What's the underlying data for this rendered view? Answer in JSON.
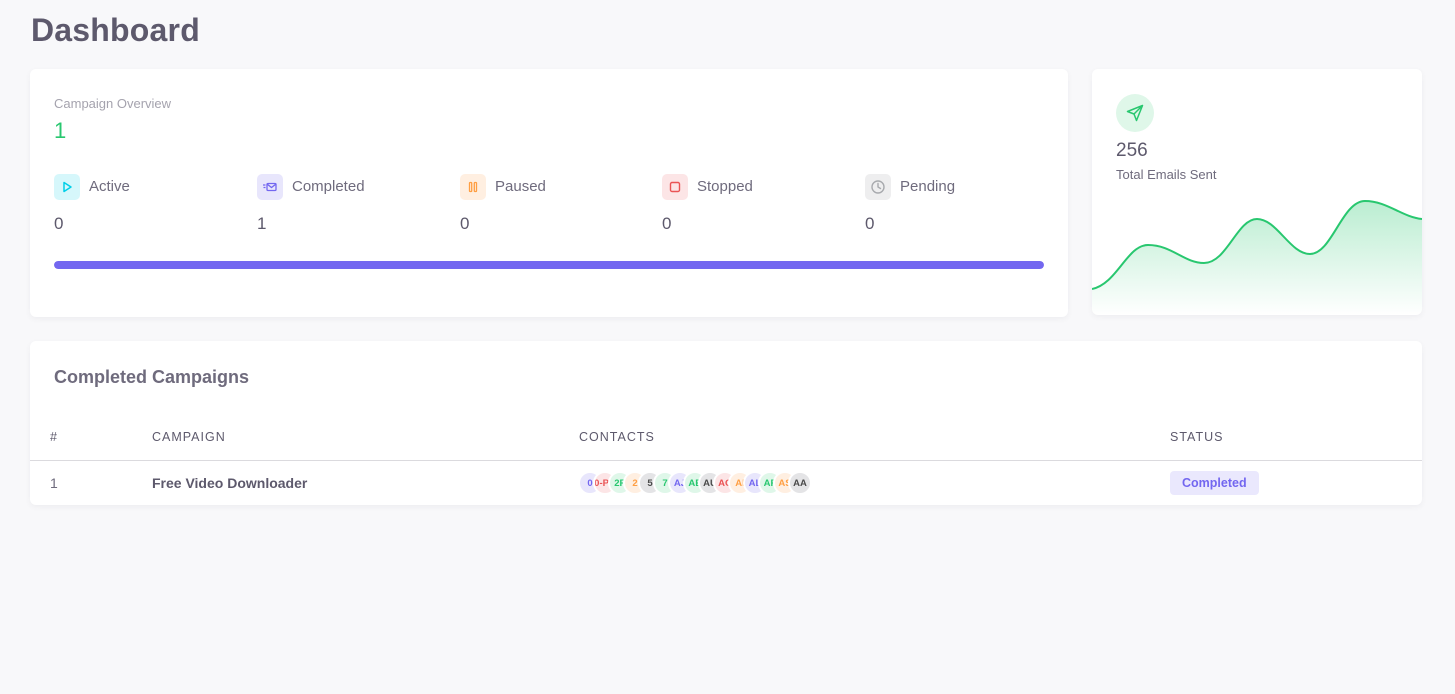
{
  "page": {
    "title": "Dashboard"
  },
  "overview": {
    "label": "Campaign Overview",
    "total": "1",
    "stats": [
      {
        "key": "active",
        "label": "Active",
        "value": "0",
        "icon": "play-icon",
        "color": "#00cfe8",
        "bg": "#d6f7fb"
      },
      {
        "key": "completed",
        "label": "Completed",
        "value": "1",
        "icon": "envelope-send-icon",
        "color": "#7367f0",
        "bg": "#e8e6fc"
      },
      {
        "key": "paused",
        "label": "Paused",
        "value": "0",
        "icon": "pause-icon",
        "color": "#ff9f43",
        "bg": "#ffefe1"
      },
      {
        "key": "stopped",
        "label": "Stopped",
        "value": "0",
        "icon": "stop-icon",
        "color": "#ea5455",
        "bg": "#fce5e6"
      },
      {
        "key": "pending",
        "label": "Pending",
        "value": "0",
        "icon": "clock-icon",
        "color": "#a8aaae",
        "bg": "#eeeeef"
      }
    ],
    "progress": {
      "completed_fraction": 1.0,
      "color": "#7367f0"
    }
  },
  "emails": {
    "value": "256",
    "label": "Total Emails Sent",
    "icon": "send-icon",
    "color": "#28c76f"
  },
  "completed_campaigns": {
    "title": "Completed Campaigns",
    "headers": {
      "index": "#",
      "campaign": "CAMPAIGN",
      "contacts": "CONTACTS",
      "status": "STATUS"
    },
    "rows": [
      {
        "index": "1",
        "campaign": "Free Video Downloader",
        "status": "Completed",
        "contacts": [
          {
            "initials": "0",
            "fg": "#7367f0",
            "bg": "#e8e6fc"
          },
          {
            "initials": "0-PK",
            "fg": "#ea5455",
            "bg": "#fce5e6"
          },
          {
            "initials": "2P",
            "fg": "#28c76f",
            "bg": "#dff7e9"
          },
          {
            "initials": "2",
            "fg": "#ff9f43",
            "bg": "#ffefe1"
          },
          {
            "initials": "5",
            "fg": "#4b4b4b",
            "bg": "#e4e4e6"
          },
          {
            "initials": "7",
            "fg": "#28c76f",
            "bg": "#dff7e9"
          },
          {
            "initials": "AJ",
            "fg": "#7367f0",
            "bg": "#e8e6fc"
          },
          {
            "initials": "AE",
            "fg": "#28c76f",
            "bg": "#dff7e9"
          },
          {
            "initials": "AU",
            "fg": "#4b4b4b",
            "bg": "#e4e4e6"
          },
          {
            "initials": "AC",
            "fg": "#ea5455",
            "bg": "#fce5e6"
          },
          {
            "initials": "AI",
            "fg": "#ff9f43",
            "bg": "#ffefe1"
          },
          {
            "initials": "AL",
            "fg": "#7367f0",
            "bg": "#e8e6fc"
          },
          {
            "initials": "AF",
            "fg": "#28c76f",
            "bg": "#dff7e9"
          },
          {
            "initials": "AS",
            "fg": "#ff9f43",
            "bg": "#ffefe1"
          },
          {
            "initials": "AA",
            "fg": "#4b4b4b",
            "bg": "#e4e4e6"
          }
        ]
      }
    ]
  }
}
